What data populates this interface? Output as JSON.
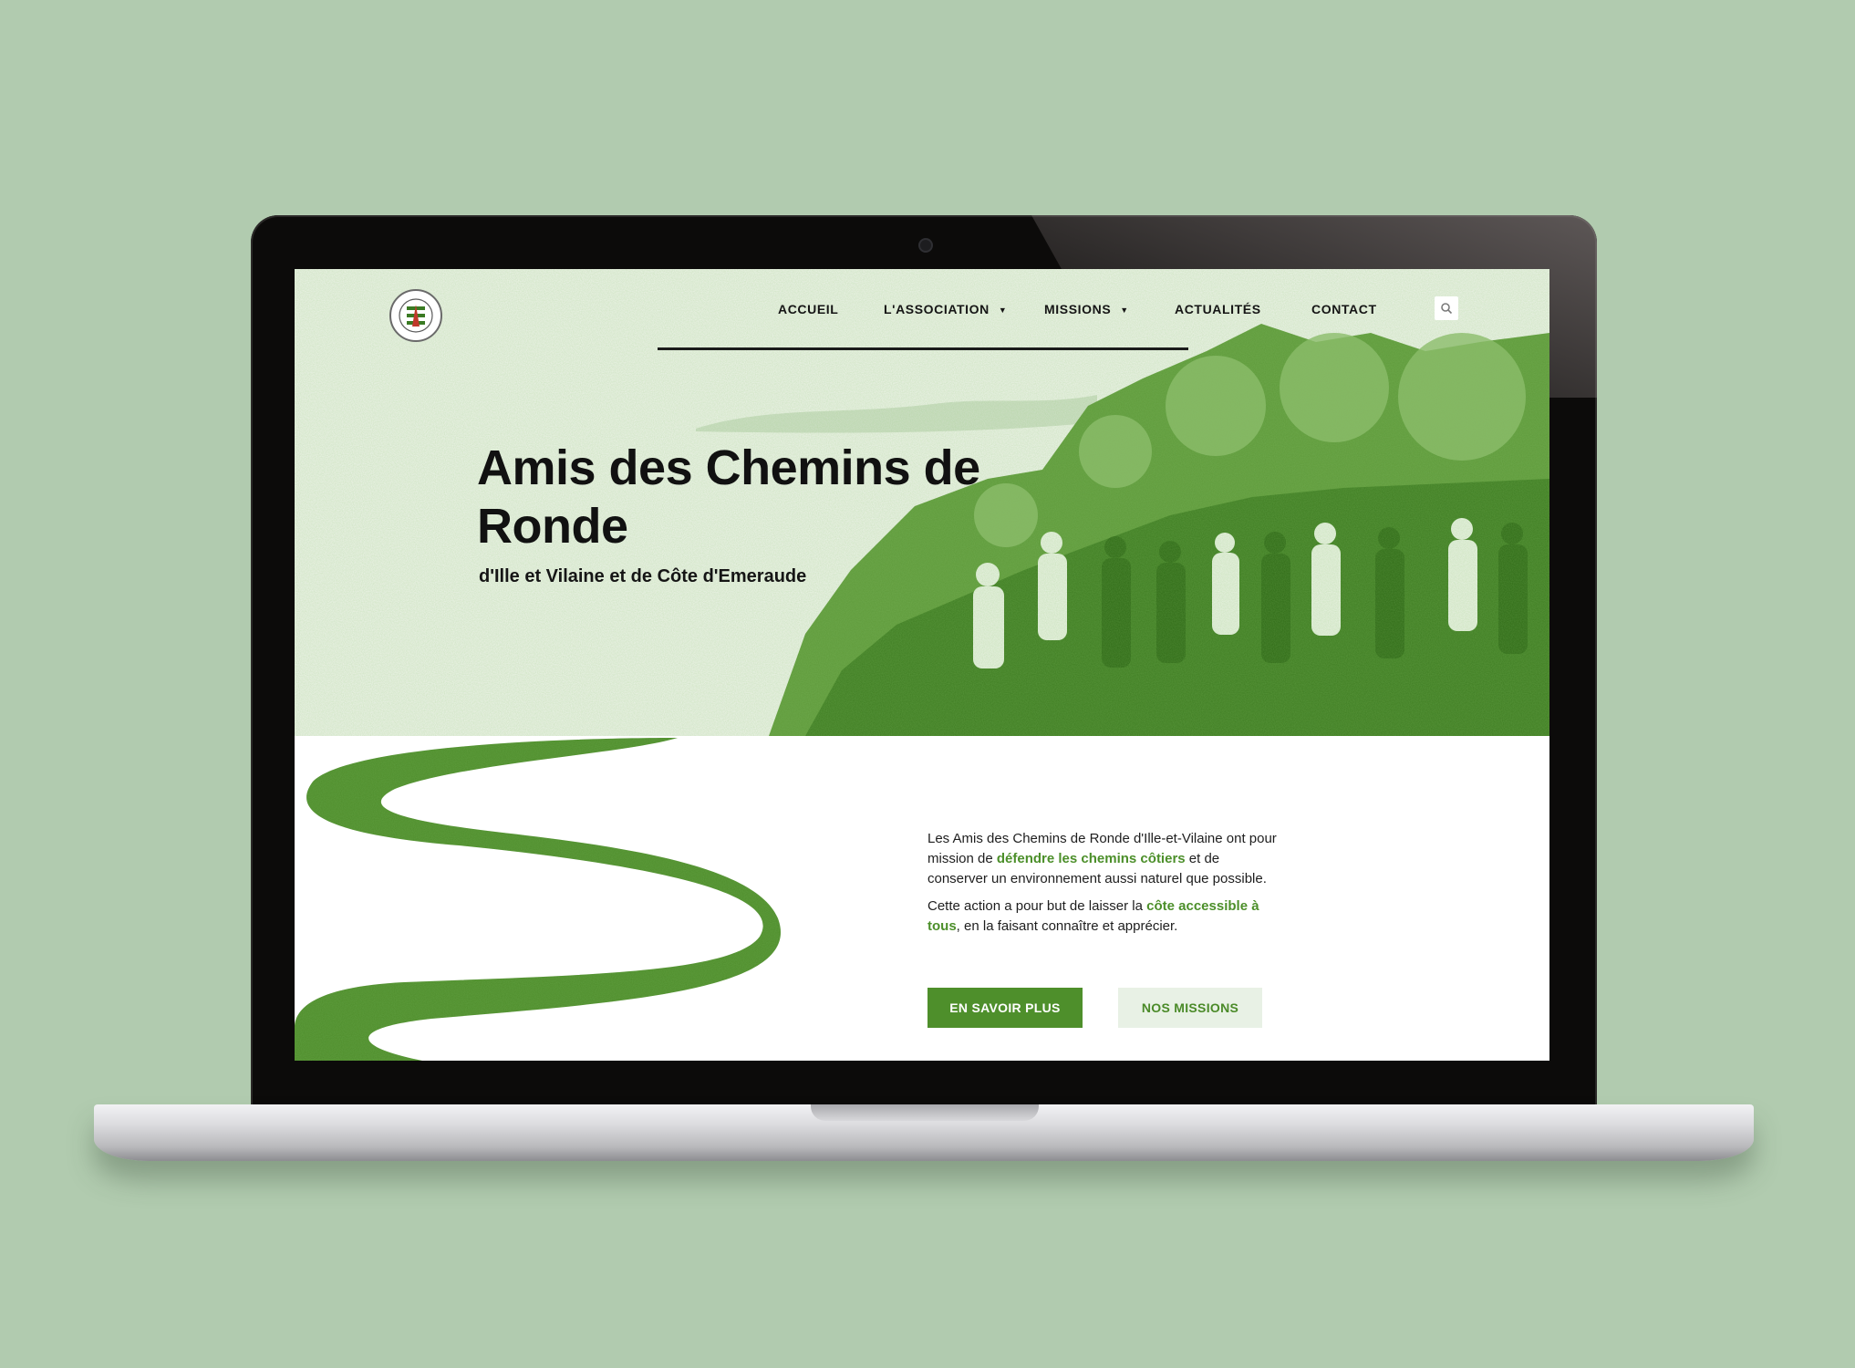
{
  "colors": {
    "background": "#b1cbaf",
    "accent_green": "#4e8f2b",
    "hero_background": "#eef3ea",
    "secondary_button": "#e8f1e5"
  },
  "header": {
    "logo_icon": "association-seal-logo",
    "nav": [
      {
        "label": "ACCUEIL",
        "has_dropdown": false
      },
      {
        "label": "L'ASSOCIATION",
        "has_dropdown": true
      },
      {
        "label": "MISSIONS",
        "has_dropdown": true
      },
      {
        "label": "ACTUALITÉS",
        "has_dropdown": false
      },
      {
        "label": "CONTACT",
        "has_dropdown": false
      }
    ],
    "dropdown_caret": "▼",
    "search_icon": "search-icon"
  },
  "hero": {
    "title": "Amis des Chemins de Ronde",
    "subtitle": "d'Ille et Vilaine et de Côte d'Emeraude"
  },
  "intro": {
    "p1_before": "Les Amis des Chemins de Ronde d'Ille-et-Vilaine ont pour mission de ",
    "p1_highlight": "défendre les chemins côtiers",
    "p1_after": " et de conserver un environnement aussi naturel que possible.",
    "p2_before": "Cette action a pour but de laisser la ",
    "p2_highlight": "côte accessible à tous",
    "p2_after": ", en la faisant connaître et apprécier."
  },
  "buttons": {
    "primary": "EN SAVOIR PLUS",
    "secondary": "NOS MISSIONS"
  }
}
